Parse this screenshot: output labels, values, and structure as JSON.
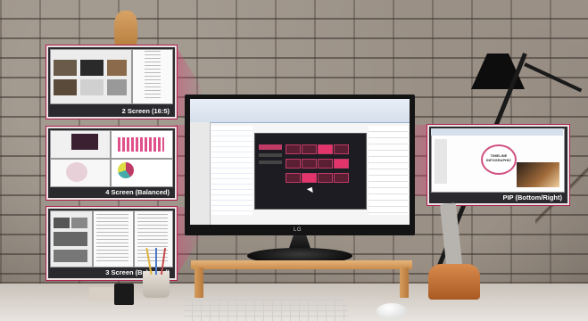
{
  "labels": {
    "two_screen": "2 Screen (16:5)",
    "four_screen": "4 Screen (Balanced)",
    "three_screen": "3 Screen (Balanced)",
    "pip": "PIP (Bottom/Right)",
    "brand": "LG",
    "pip_slide_title": "TIMELINE INFOGRAPHIC"
  },
  "colors": {
    "accent": "#d6467a",
    "border": "#b0204f"
  }
}
